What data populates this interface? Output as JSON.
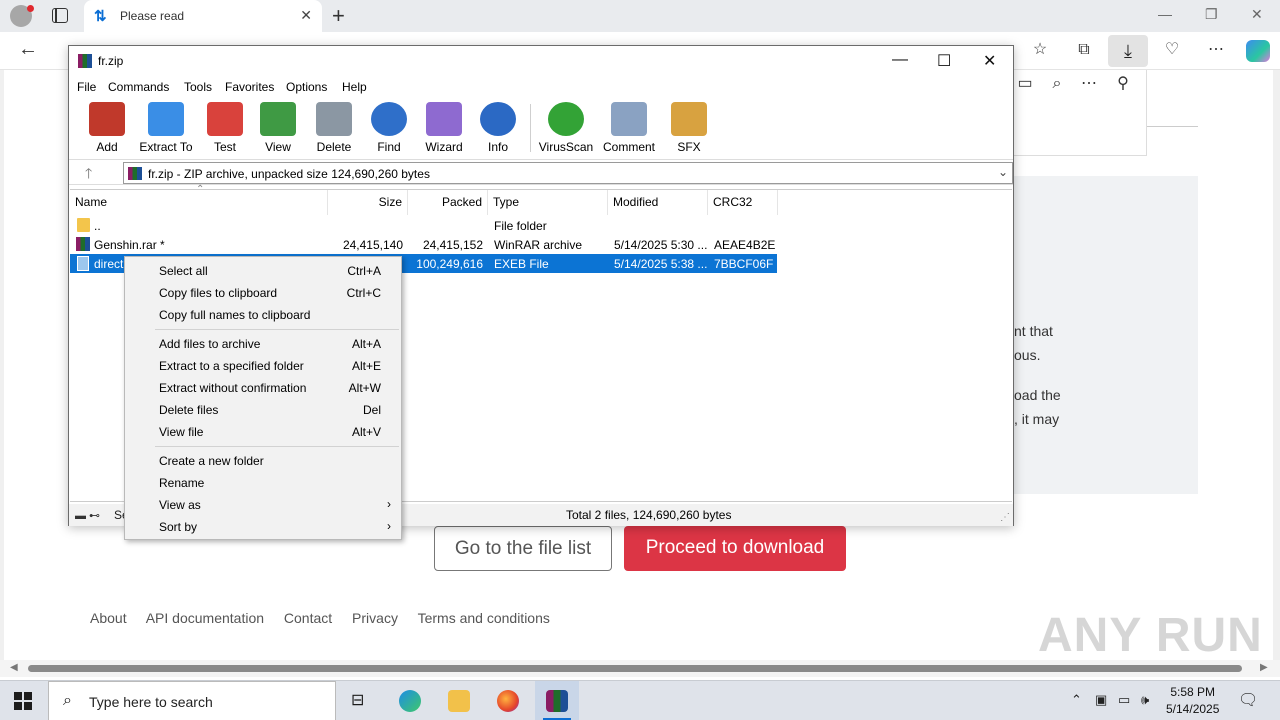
{
  "browser": {
    "tab_title": "Please read",
    "tab_close": "✕",
    "new_tab": "+",
    "back": "←"
  },
  "page": {
    "fragments": [
      "nt that",
      "ous.",
      "oad the",
      ", it may"
    ],
    "btn_filelist": "Go to the file list",
    "btn_proceed": "Proceed to download",
    "footer": [
      "About",
      "API documentation",
      "Contact",
      "Privacy",
      "Terms and conditions"
    ],
    "watermark": "ANY RUN"
  },
  "winrar": {
    "title": "fr.zip",
    "menu": [
      "File",
      "Commands",
      "Tools",
      "Favorites",
      "Options",
      "Help"
    ],
    "tools": [
      {
        "label": "Add",
        "color": "#c0392b"
      },
      {
        "label": "Extract To",
        "color": "#3a8ee6"
      },
      {
        "label": "Test",
        "color": "#d9423c"
      },
      {
        "label": "View",
        "color": "#3f9a44"
      },
      {
        "label": "Delete",
        "color": "#8b97a3"
      },
      {
        "label": "Find",
        "color": "#2f6fc9"
      },
      {
        "label": "Wizard",
        "color": "#8e6ad0"
      },
      {
        "label": "Info",
        "color": "#2b69c4"
      },
      {
        "label": "VirusScan",
        "color": "#33a336"
      },
      {
        "label": "Comment",
        "color": "#8aa2c2"
      },
      {
        "label": "SFX",
        "color": "#d8a240"
      }
    ],
    "path": "fr.zip - ZIP archive, unpacked size 124,690,260 bytes",
    "columns": [
      "Name",
      "Size",
      "Packed",
      "Type",
      "Modified",
      "CRC32"
    ],
    "rows": [
      {
        "name": "..",
        "size": "",
        "packed": "",
        "type": "File folder",
        "modified": "",
        "crc": ""
      },
      {
        "name": "Genshin.rar *",
        "size": "24,415,140",
        "packed": "24,415,152",
        "type": "WinRAR archive",
        "modified": "5/14/2025 5:30 ...",
        "crc": "AEAE4B2E"
      },
      {
        "name": "direct",
        "size": "",
        "packed": "100,249,616",
        "type": "EXEB File",
        "modified": "5/14/2025 5:38 ...",
        "crc": "7BBCF06F"
      }
    ],
    "status_left": "Se",
    "status_total": "Total 2 files, 124,690,260 bytes"
  },
  "context_menu": {
    "items": [
      {
        "label": "Select all",
        "key": "Ctrl+A"
      },
      {
        "label": "Copy files to clipboard",
        "key": "Ctrl+C"
      },
      {
        "label": "Copy full names to clipboard",
        "key": ""
      },
      {
        "label": "Add files to archive",
        "key": "Alt+A"
      },
      {
        "label": "Extract to a specified folder",
        "key": "Alt+E"
      },
      {
        "label": "Extract without confirmation",
        "key": "Alt+W"
      },
      {
        "label": "Delete files",
        "key": "Del"
      },
      {
        "label": "View file",
        "key": "Alt+V"
      },
      {
        "label": "Create a new folder",
        "key": ""
      },
      {
        "label": "Rename",
        "key": ""
      },
      {
        "label": "View as",
        "key": "›"
      },
      {
        "label": "Sort by",
        "key": "›"
      }
    ]
  },
  "taskbar": {
    "search_placeholder": "Type here to search",
    "time": "5:58 PM",
    "date": "5/14/2025"
  }
}
